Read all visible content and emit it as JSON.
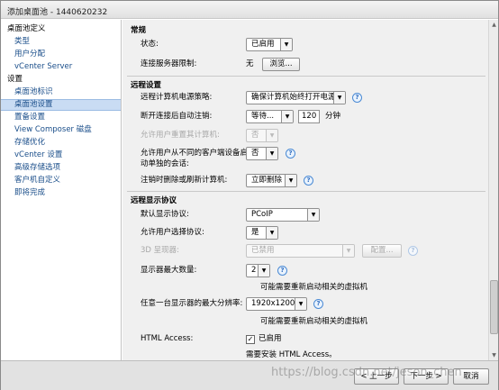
{
  "window": {
    "title": "添加桌面池 - 1440620232"
  },
  "sidebar": {
    "items": [
      {
        "label": "桌面池定义",
        "head": true
      },
      {
        "label": "类型"
      },
      {
        "label": "用户分配"
      },
      {
        "label": "vCenter Server"
      },
      {
        "label": "设置",
        "head": true
      },
      {
        "label": "桌面池标识"
      },
      {
        "label": "桌面池设置",
        "selected": true
      },
      {
        "label": "置备设置"
      },
      {
        "label": "View Composer 磁盘"
      },
      {
        "label": "存储优化"
      },
      {
        "label": "vCenter 设置"
      },
      {
        "label": "高级存储选项"
      },
      {
        "label": "客户机自定义"
      },
      {
        "label": "即将完成"
      }
    ]
  },
  "general": {
    "heading": "常规",
    "state_label": "状态:",
    "state_value": "已启用",
    "conn_label": "连接服务器限制:",
    "conn_value": "无",
    "browse_label": "浏览..."
  },
  "remote": {
    "heading": "远程设置",
    "power_label": "远程计算机电源策略:",
    "power_value": "确保计算机始终打开电源",
    "disconnect_label": "断开连接后自动注销:",
    "disconnect_value": "等待...",
    "disconnect_minutes": "120",
    "minutes_unit": "分钟",
    "reset_label": "允许用户重置其计算机:",
    "reset_value": "否",
    "multi_label_1": "允许用户从不同的客户端设备启",
    "multi_label_2": "动单独的会话:",
    "multi_value": "否",
    "logoff_label": "注销时删除或刷新计算机:",
    "logoff_value": "立即删除"
  },
  "display": {
    "heading": "远程显示协议",
    "proto_label": "默认显示协议:",
    "proto_value": "PCoIP",
    "choose_label": "允许用户选择协议:",
    "choose_value": "是",
    "render_label": "3D 呈现器:",
    "render_value": "已禁用",
    "config_label": "配置...",
    "monitors_label": "显示器最大数量:",
    "monitors_value": "2",
    "note1": "可能需要重新启动相关的虚拟机",
    "res_label": "任意一台显示器的最大分辨率:",
    "res_value": "1920x1200",
    "note2": "可能需要重新启动相关的虚拟机",
    "html_label": "HTML Access:",
    "html_check": "已启用",
    "html_note": "需要安装 HTML Access。"
  },
  "footer": {
    "back": "< 上一步",
    "next": "下一步 >",
    "cancel": "取消"
  },
  "watermark": "https://blog.csdn.net/jeson_chen"
}
